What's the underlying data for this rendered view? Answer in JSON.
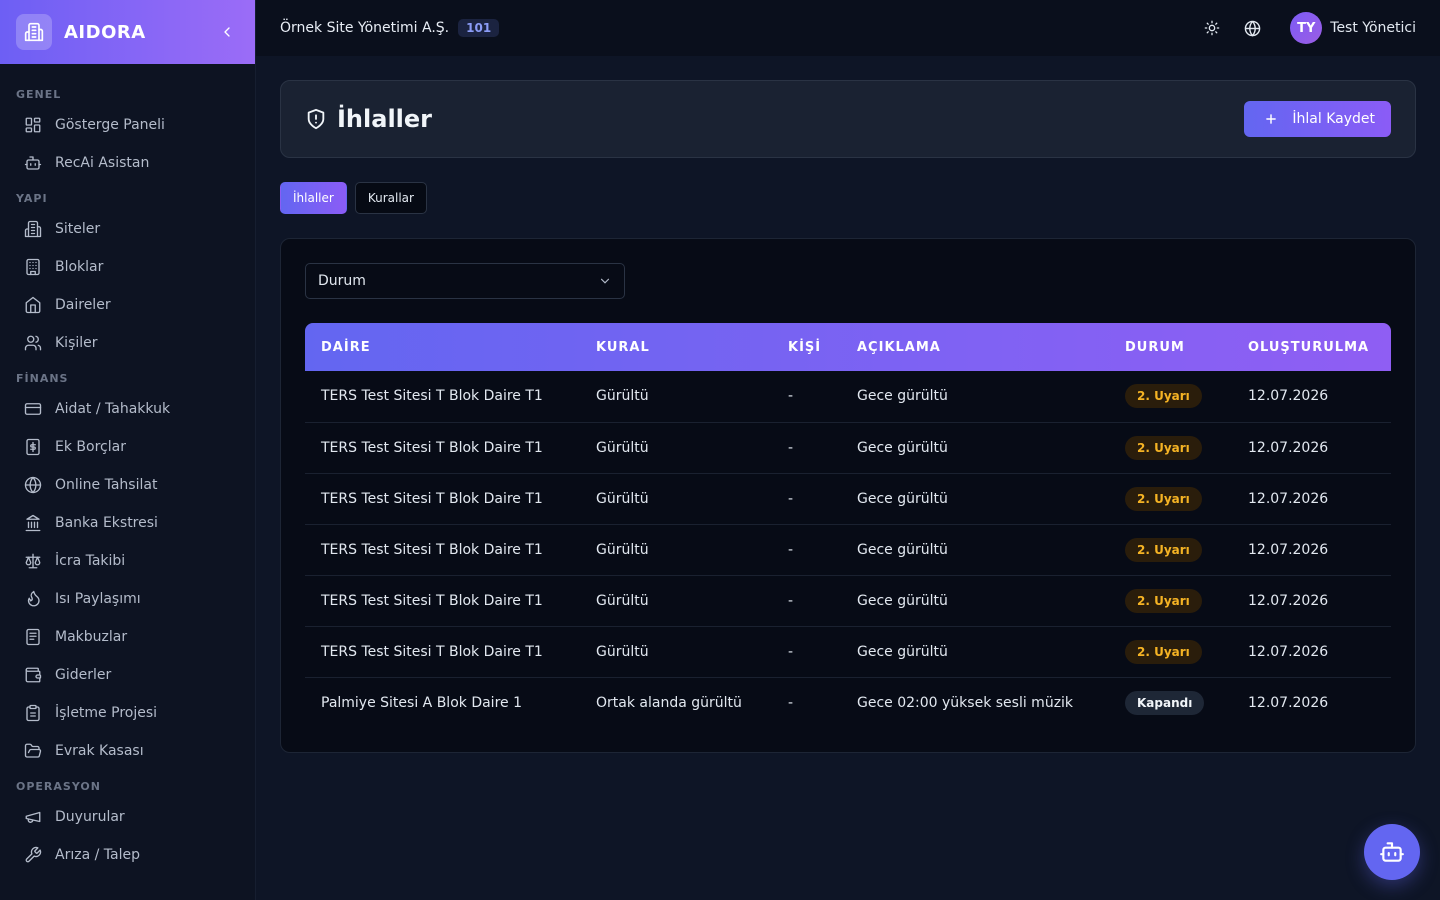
{
  "brand": {
    "name": "AIDORA"
  },
  "sidebar": {
    "sections": [
      {
        "title": "GENEL",
        "items": [
          {
            "label": "Gösterge Paneli",
            "icon": "dashboard-icon"
          },
          {
            "label": "RecAi Asistan",
            "icon": "bot-icon"
          }
        ]
      },
      {
        "title": "YAPI",
        "items": [
          {
            "label": "Siteler",
            "icon": "buildings-icon"
          },
          {
            "label": "Bloklar",
            "icon": "building-icon"
          },
          {
            "label": "Daireler",
            "icon": "home-icon"
          },
          {
            "label": "Kişiler",
            "icon": "users-icon"
          }
        ]
      },
      {
        "title": "FİNANS",
        "items": [
          {
            "label": "Aidat / Tahakkuk",
            "icon": "credit-card-icon"
          },
          {
            "label": "Ek Borçlar",
            "icon": "dollar-receipt-icon"
          },
          {
            "label": "Online Tahsilat",
            "icon": "globe-icon"
          },
          {
            "label": "Banka Ekstresi",
            "icon": "bank-icon"
          },
          {
            "label": "İcra Takibi",
            "icon": "scale-icon"
          },
          {
            "label": "Isı Paylaşımı",
            "icon": "flame-icon"
          },
          {
            "label": "Makbuzlar",
            "icon": "receipt-icon"
          },
          {
            "label": "Giderler",
            "icon": "wallet-icon"
          },
          {
            "label": "İşletme Projesi",
            "icon": "clipboard-icon"
          },
          {
            "label": "Evrak Kasası",
            "icon": "folder-icon"
          }
        ]
      },
      {
        "title": "OPERASYON",
        "items": [
          {
            "label": "Duyurular",
            "icon": "megaphone-icon"
          },
          {
            "label": "Arıza / Talep",
            "icon": "wrench-icon"
          }
        ]
      }
    ]
  },
  "topbar": {
    "org_name": "Örnek Site Yönetimi A.Ş.",
    "org_badge": "101",
    "user_initials": "TY",
    "user_name": "Test Yönetici"
  },
  "page": {
    "title": "İhlaller",
    "primary_button": "İhlal Kaydet",
    "tabs": [
      {
        "label": "İhlaller",
        "active": true
      },
      {
        "label": "Kurallar",
        "active": false
      }
    ],
    "filter": {
      "value": "Durum"
    }
  },
  "table": {
    "columns": [
      "DAİRE",
      "KURAL",
      "KİŞİ",
      "AÇIKLAMA",
      "DURUM",
      "OLUŞTURULMA"
    ],
    "rows": [
      {
        "daire": "TERS Test Sitesi T Blok Daire T1",
        "kural": "Gürültü",
        "kisi": "-",
        "aciklama": "Gece gürültü",
        "durum": "2. Uyarı",
        "durum_type": "warn",
        "tarih": "12.07.2026"
      },
      {
        "daire": "TERS Test Sitesi T Blok Daire T1",
        "kural": "Gürültü",
        "kisi": "-",
        "aciklama": "Gece gürültü",
        "durum": "2. Uyarı",
        "durum_type": "warn",
        "tarih": "12.07.2026"
      },
      {
        "daire": "TERS Test Sitesi T Blok Daire T1",
        "kural": "Gürültü",
        "kisi": "-",
        "aciklama": "Gece gürültü",
        "durum": "2. Uyarı",
        "durum_type": "warn",
        "tarih": "12.07.2026"
      },
      {
        "daire": "TERS Test Sitesi T Blok Daire T1",
        "kural": "Gürültü",
        "kisi": "-",
        "aciklama": "Gece gürültü",
        "durum": "2. Uyarı",
        "durum_type": "warn",
        "tarih": "12.07.2026"
      },
      {
        "daire": "TERS Test Sitesi T Blok Daire T1",
        "kural": "Gürültü",
        "kisi": "-",
        "aciklama": "Gece gürültü",
        "durum": "2. Uyarı",
        "durum_type": "warn",
        "tarih": "12.07.2026"
      },
      {
        "daire": "TERS Test Sitesi T Blok Daire T1",
        "kural": "Gürültü",
        "kisi": "-",
        "aciklama": "Gece gürültü",
        "durum": "2. Uyarı",
        "durum_type": "warn",
        "tarih": "12.07.2026"
      },
      {
        "daire": "Palmiye Sitesi A Blok Daire 1",
        "kural": "Ortak alanda gürültü",
        "kisi": "-",
        "aciklama": "Gece 02:00 yüksek sesli müzik",
        "durum": "Kapandı",
        "durum_type": "closed",
        "tarih": "12.07.2026"
      }
    ]
  },
  "colors": {
    "accent": "#6366f1",
    "accent2": "#8b5cf6",
    "warn": "#f5b324"
  }
}
